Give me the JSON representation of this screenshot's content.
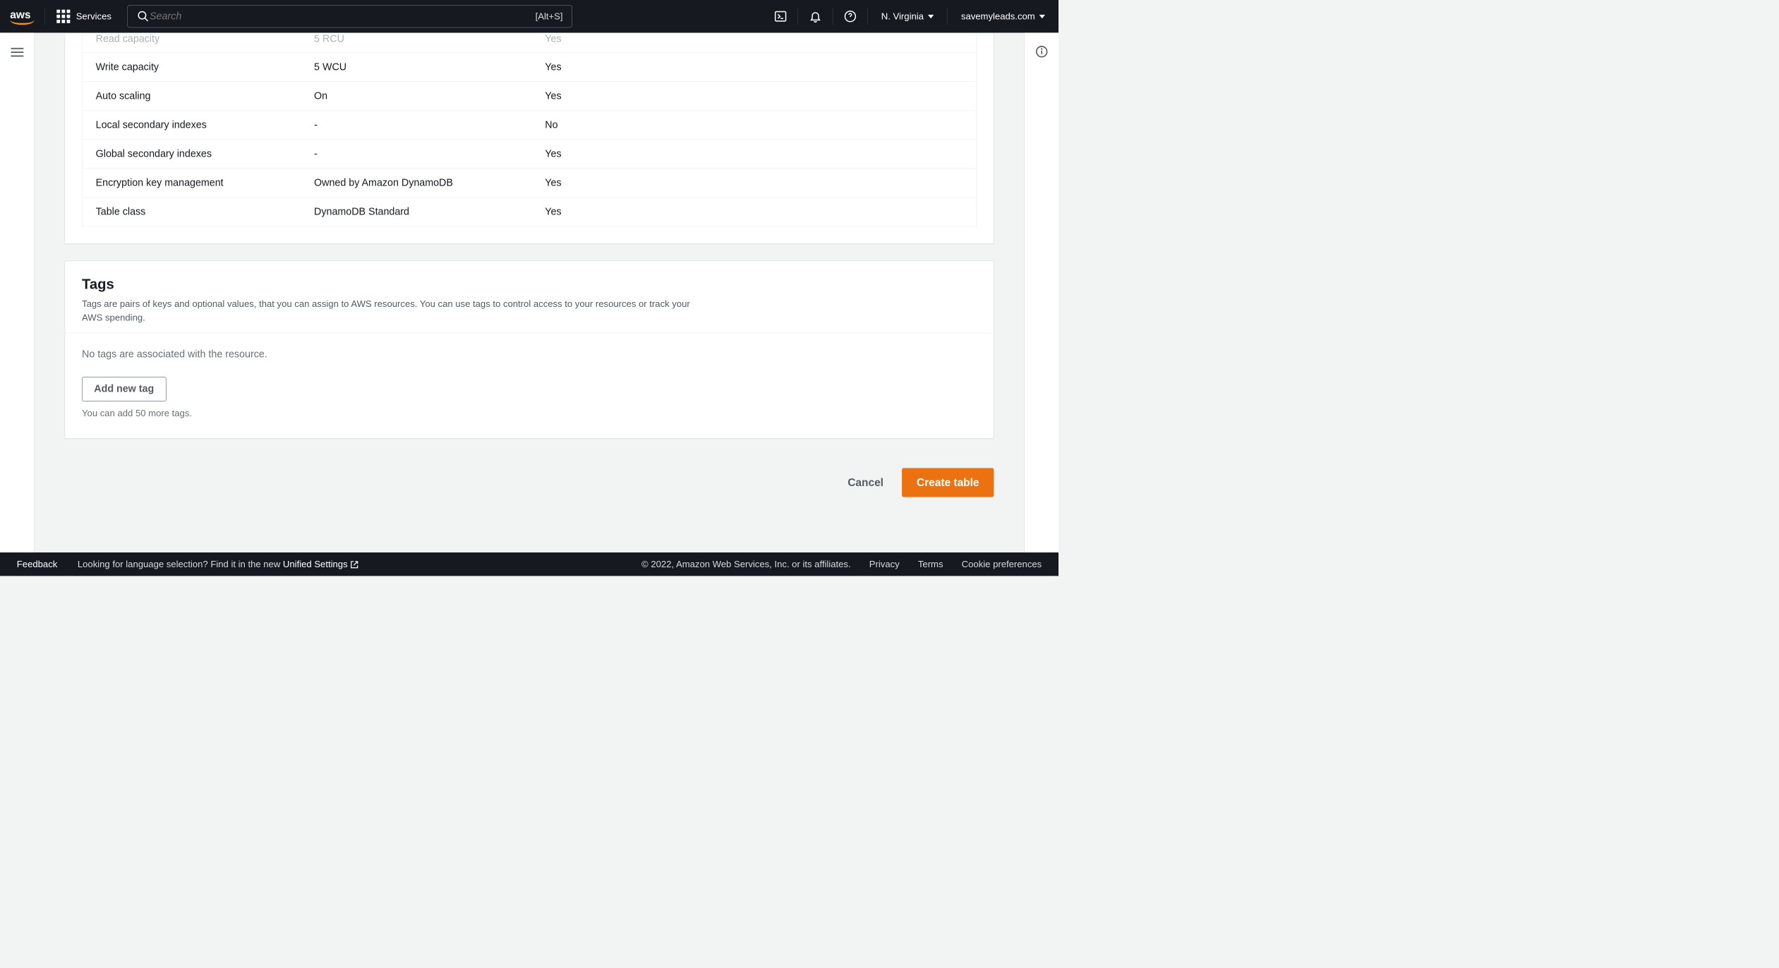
{
  "header": {
    "services_label": "Services",
    "search_placeholder": "Search",
    "search_shortcut": "[Alt+S]",
    "region": "N. Virginia",
    "account": "savemyleads.com"
  },
  "settings_table": {
    "rows": [
      {
        "label": "Read capacity",
        "value": "5 RCU",
        "editable": "Yes"
      },
      {
        "label": "Write capacity",
        "value": "5 WCU",
        "editable": "Yes"
      },
      {
        "label": "Auto scaling",
        "value": "On",
        "editable": "Yes"
      },
      {
        "label": "Local secondary indexes",
        "value": "-",
        "editable": "No"
      },
      {
        "label": "Global secondary indexes",
        "value": "-",
        "editable": "Yes"
      },
      {
        "label": "Encryption key management",
        "value": "Owned by Amazon DynamoDB",
        "editable": "Yes"
      },
      {
        "label": "Table class",
        "value": "DynamoDB Standard",
        "editable": "Yes"
      }
    ]
  },
  "tags": {
    "heading": "Tags",
    "description": "Tags are pairs of keys and optional values, that you can assign to AWS resources. You can use tags to control access to your resources or track your AWS spending.",
    "empty_text": "No tags are associated with the resource.",
    "add_button": "Add new tag",
    "hint": "You can add 50 more tags."
  },
  "actions": {
    "cancel": "Cancel",
    "create": "Create table"
  },
  "footer": {
    "feedback": "Feedback",
    "lang_prompt": "Looking for language selection? Find it in the new ",
    "lang_link": "Unified Settings",
    "copyright": "© 2022, Amazon Web Services, Inc. or its affiliates.",
    "privacy": "Privacy",
    "terms": "Terms",
    "cookies": "Cookie preferences"
  }
}
